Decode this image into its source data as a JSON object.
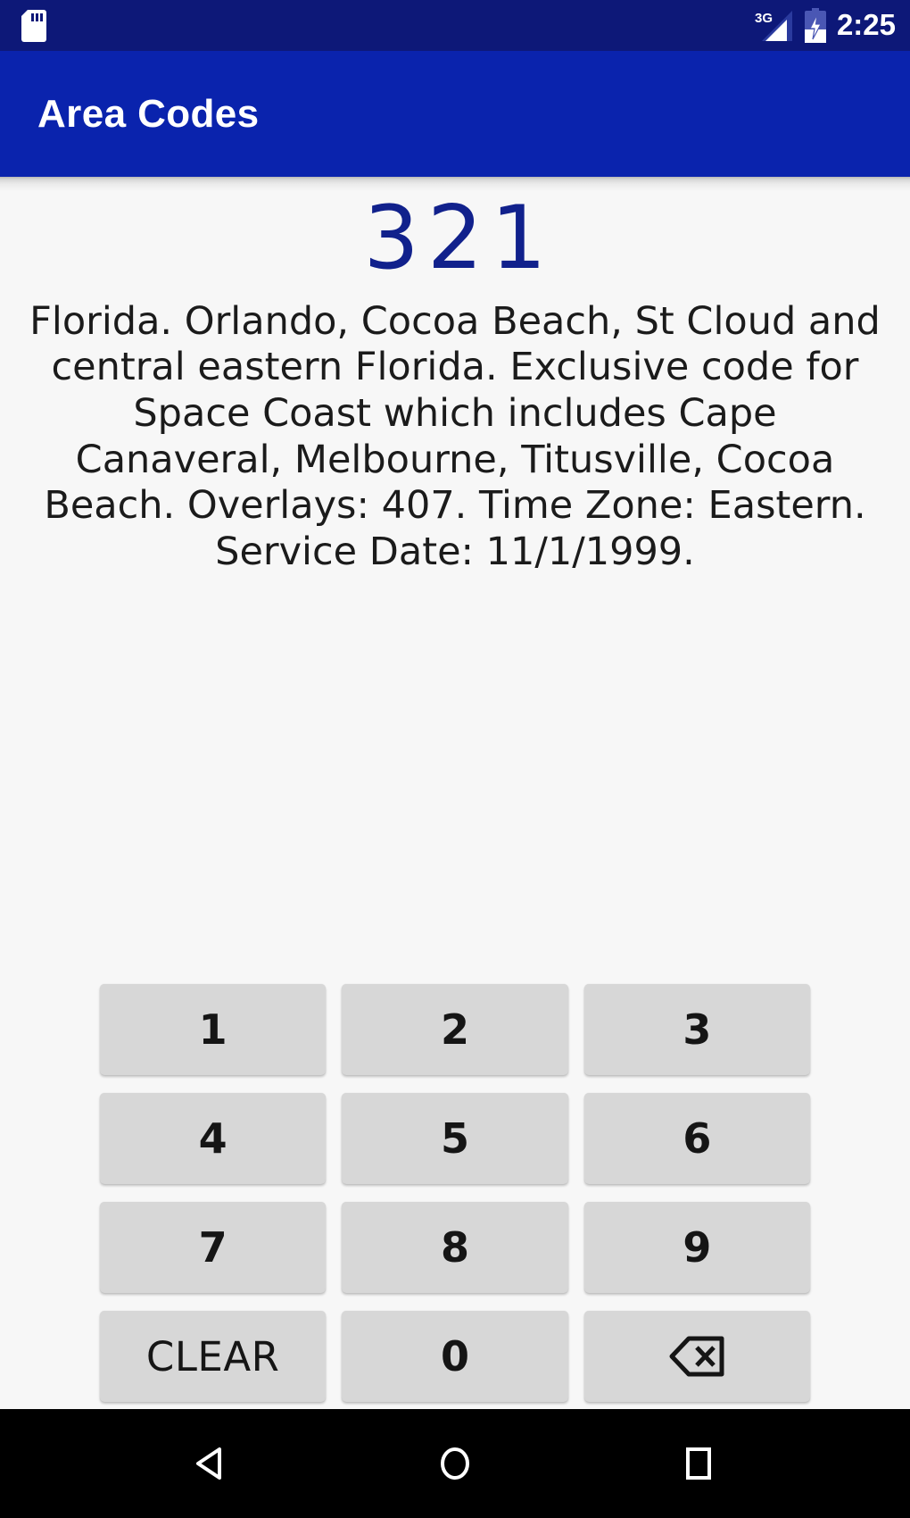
{
  "status_bar": {
    "background_color": "#0d1878",
    "sdcard_icon": "sd-card-icon",
    "network_label": "3G",
    "signal_icon": "signal-bars-icon",
    "battery_icon": "battery-charging-icon",
    "time": "2:25"
  },
  "app_bar": {
    "title": "Area Codes",
    "background_color": "#0a23ad",
    "title_color": "#ffffff"
  },
  "content": {
    "area_code": "321",
    "area_code_color": "#11218c",
    "description": "Florida. Orlando, Cocoa Beach, St Cloud and central eastern Florida. Exclusive code for Space Coast which includes Cape Canaveral, Melbourne, Titusville, Cocoa Beach. Overlays: 407. Time Zone: Eastern. Service Date: 11/1/1999.",
    "background_color": "#f7f7f7"
  },
  "keypad": {
    "key_background_color": "#d7d7d7",
    "key_text_color": "#151515",
    "rows": [
      [
        {
          "label": "1",
          "name": "key-1",
          "kind": "digit"
        },
        {
          "label": "2",
          "name": "key-2",
          "kind": "digit"
        },
        {
          "label": "3",
          "name": "key-3",
          "kind": "digit"
        }
      ],
      [
        {
          "label": "4",
          "name": "key-4",
          "kind": "digit"
        },
        {
          "label": "5",
          "name": "key-5",
          "kind": "digit"
        },
        {
          "label": "6",
          "name": "key-6",
          "kind": "digit"
        }
      ],
      [
        {
          "label": "7",
          "name": "key-7",
          "kind": "digit"
        },
        {
          "label": "8",
          "name": "key-8",
          "kind": "digit"
        },
        {
          "label": "9",
          "name": "key-9",
          "kind": "digit"
        }
      ],
      [
        {
          "label": "CLEAR",
          "name": "key-clear",
          "kind": "text"
        },
        {
          "label": "0",
          "name": "key-0",
          "kind": "digit"
        },
        {
          "label": "",
          "name": "key-backspace",
          "kind": "icon",
          "icon": "backspace-icon"
        }
      ]
    ],
    "clear_label": "CLEAR",
    "zero_label": "0",
    "backspace_icon": "backspace-icon"
  },
  "nav_bar": {
    "background_color": "#000000",
    "buttons": [
      {
        "name": "nav-back-button",
        "icon": "back-triangle-icon"
      },
      {
        "name": "nav-home-button",
        "icon": "home-circle-icon"
      },
      {
        "name": "nav-recents-button",
        "icon": "recents-square-icon"
      }
    ]
  }
}
